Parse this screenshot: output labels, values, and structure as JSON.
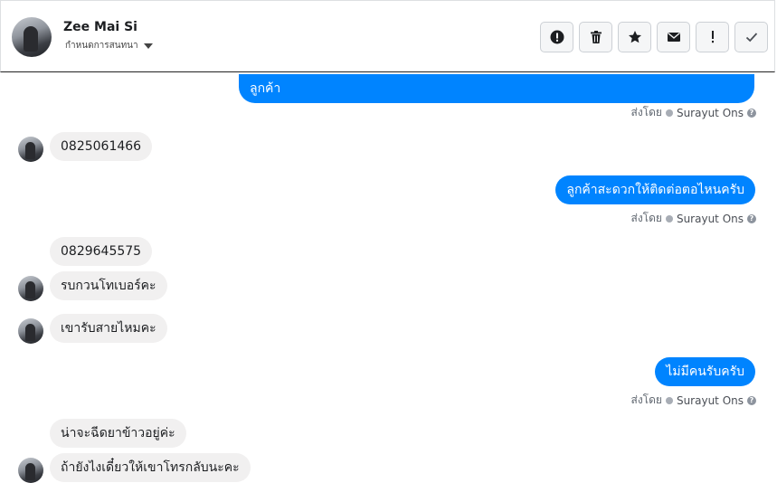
{
  "header": {
    "contact_name": "Zee Mai Si",
    "stage_label": "กำหนดการสนทนา"
  },
  "toolbar": {
    "icons": [
      "alert-circle-icon",
      "trash-icon",
      "star-icon",
      "envelope-icon",
      "exclamation-icon",
      "check-icon"
    ]
  },
  "messages": {
    "m1": "ลูกค้า",
    "m2": "0825061466",
    "m3": "ลูกค้าสะดวกให้ติดต่อตอไหนครับ",
    "m4": "0829645575",
    "m5": "รบกวนโทเบอร์คะ",
    "m6": "เขารับสายไหมคะ",
    "m7": "ไม่มีคนรับครับ",
    "m8": "น่าจะฉีดยาข้าวอยู่ค่ะ",
    "m9": "ถ้ายังไงเดี๋ยวให้เขาโทรกลับนะคะ"
  },
  "sent_by": {
    "prefix": "ส่งโดย",
    "agent": "Surayut Ons",
    "help": "?"
  },
  "colors": {
    "outgoing_bubble": "#0084ff",
    "incoming_bubble": "#f1f0f0"
  }
}
